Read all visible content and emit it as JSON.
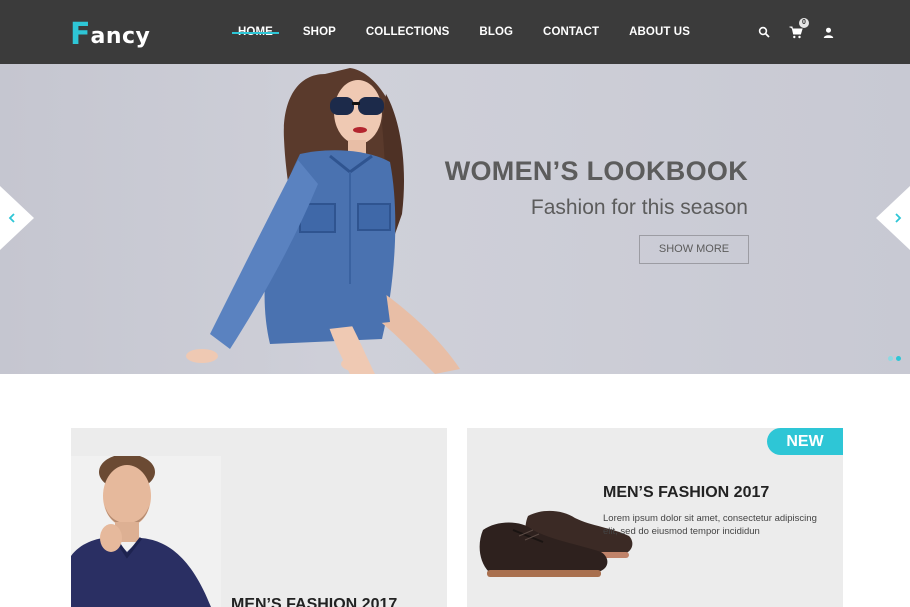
{
  "brand": {
    "logo_first": "F",
    "logo_rest": "ancy"
  },
  "nav": {
    "items": [
      {
        "label": "HOME",
        "active": true
      },
      {
        "label": "SHOP"
      },
      {
        "label": "COLLECTIONS"
      },
      {
        "label": "BLOG"
      },
      {
        "label": "CONTACT"
      },
      {
        "label": "ABOUT US"
      }
    ],
    "cart_count": "0",
    "icons": [
      "search-icon",
      "cart-icon",
      "user-icon"
    ]
  },
  "hero": {
    "title": "WOMEN’S LOOKBOOK",
    "subtitle": "Fashion for this season",
    "button": "SHOW MORE",
    "slides_total": 2,
    "active_slide": 2
  },
  "products": [
    {
      "title": "MEN’S FASHION 2017"
    },
    {
      "badge": "NEW",
      "title": "MEN’S FASHION 2017",
      "description": "Lorem ipsum dolor sit amet, consectetur adipiscing elit, sed do eiusmod tempor incididun"
    }
  ],
  "colors": {
    "accent": "#2ec6d6",
    "header_bg": "#3b3b3b",
    "hero_text": "#5c5c5c",
    "card_bg": "#ececec"
  }
}
